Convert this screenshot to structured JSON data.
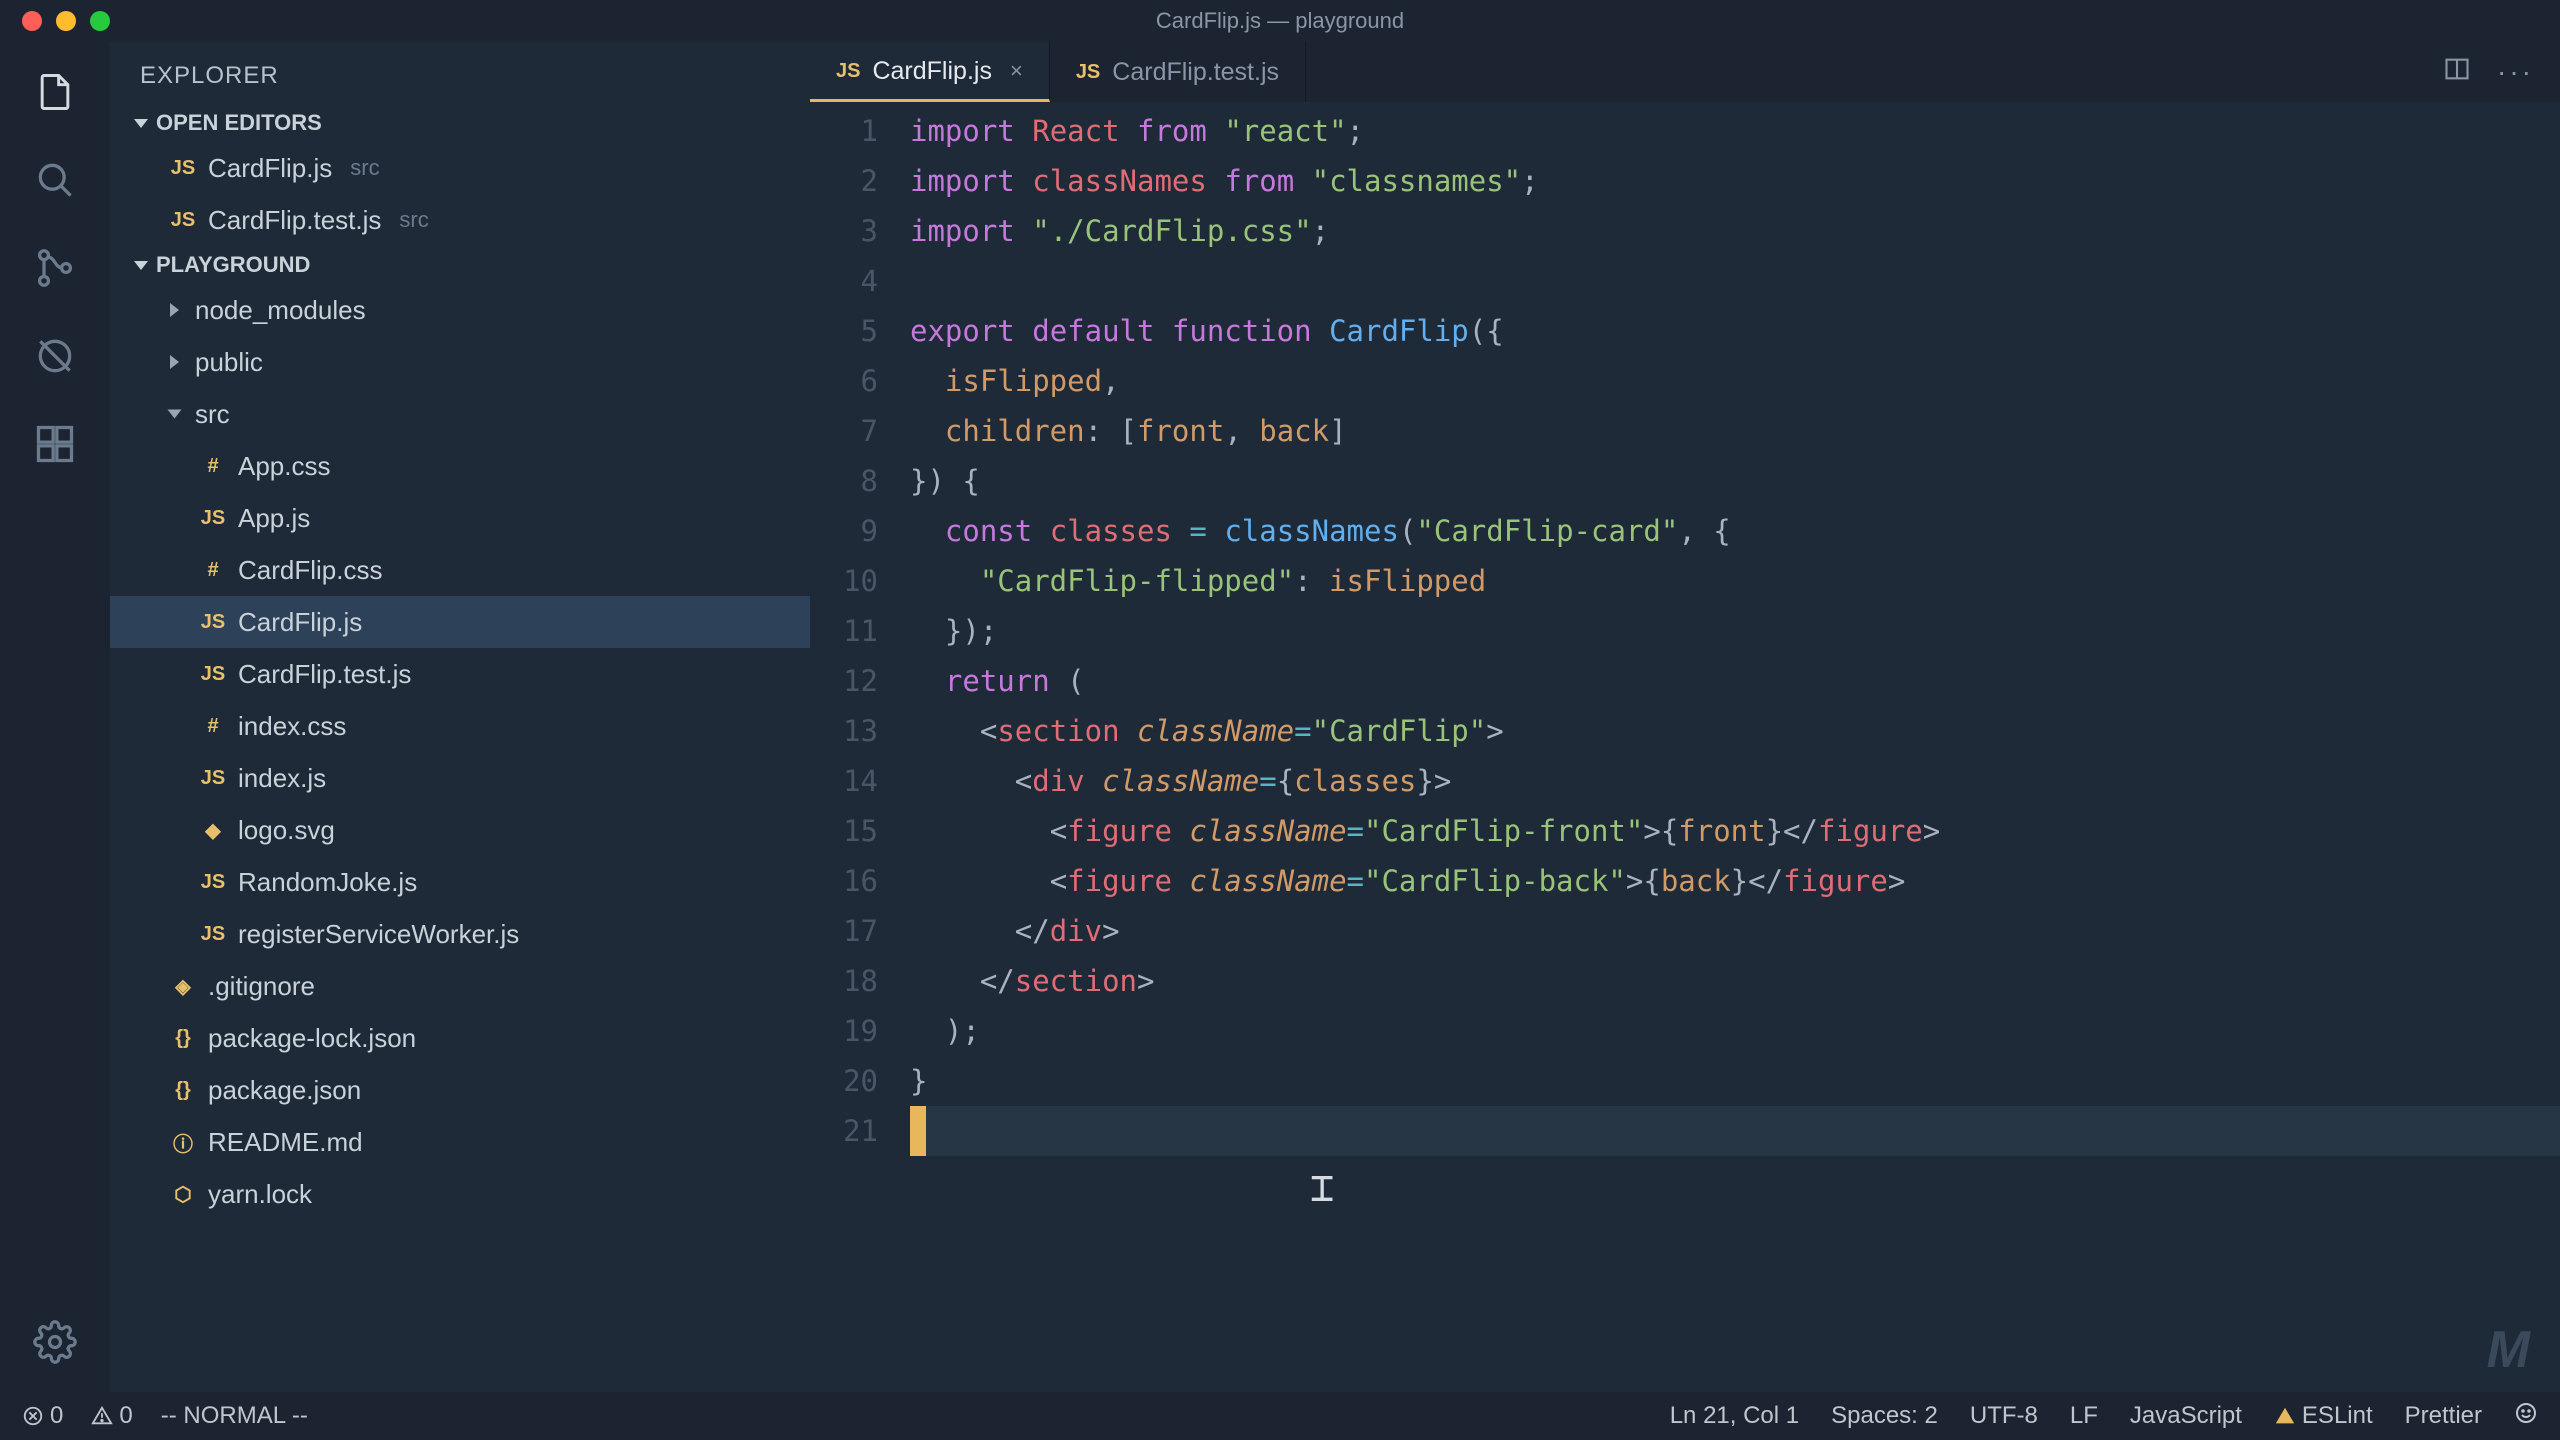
{
  "window_title": "CardFlip.js — playground",
  "sidebar": {
    "title": "EXPLORER",
    "open_editors_label": "OPEN EDITORS",
    "open_editors": [
      {
        "icon": "JS",
        "name": "CardFlip.js",
        "dir": "src"
      },
      {
        "icon": "JS",
        "name": "CardFlip.test.js",
        "dir": "src"
      }
    ],
    "project_label": "PLAYGROUND",
    "tree": [
      {
        "type": "folder",
        "name": "node_modules",
        "open": false,
        "indent": 1
      },
      {
        "type": "folder",
        "name": "public",
        "open": false,
        "indent": 1
      },
      {
        "type": "folder",
        "name": "src",
        "open": true,
        "indent": 1
      },
      {
        "type": "file",
        "icon": "#",
        "iconClass": "icon-hash",
        "name": "App.css",
        "indent": 2
      },
      {
        "type": "file",
        "icon": "JS",
        "iconClass": "icon-js",
        "name": "App.js",
        "indent": 2
      },
      {
        "type": "file",
        "icon": "#",
        "iconClass": "icon-hash",
        "name": "CardFlip.css",
        "indent": 2
      },
      {
        "type": "file",
        "icon": "JS",
        "iconClass": "icon-js",
        "name": "CardFlip.js",
        "indent": 2,
        "selected": true
      },
      {
        "type": "file",
        "icon": "JS",
        "iconClass": "icon-js",
        "name": "CardFlip.test.js",
        "indent": 2
      },
      {
        "type": "file",
        "icon": "#",
        "iconClass": "icon-hash",
        "name": "index.css",
        "indent": 2
      },
      {
        "type": "file",
        "icon": "JS",
        "iconClass": "icon-js",
        "name": "index.js",
        "indent": 2
      },
      {
        "type": "file",
        "icon": "◆",
        "iconClass": "icon-svg",
        "name": "logo.svg",
        "indent": 2
      },
      {
        "type": "file",
        "icon": "JS",
        "iconClass": "icon-js",
        "name": "RandomJoke.js",
        "indent": 2
      },
      {
        "type": "file",
        "icon": "JS",
        "iconClass": "icon-js",
        "name": "registerServiceWorker.js",
        "indent": 2
      },
      {
        "type": "file",
        "icon": "◈",
        "iconClass": "icon-git",
        "name": ".gitignore",
        "indent": 1
      },
      {
        "type": "file",
        "icon": "{}",
        "iconClass": "icon-braces",
        "name": "package-lock.json",
        "indent": 1
      },
      {
        "type": "file",
        "icon": "{}",
        "iconClass": "icon-braces",
        "name": "package.json",
        "indent": 1
      },
      {
        "type": "file",
        "icon": "ⓘ",
        "iconClass": "icon-info",
        "name": "README.md",
        "indent": 1
      },
      {
        "type": "file",
        "icon": "⬡",
        "iconClass": "icon-yarn",
        "name": "yarn.lock",
        "indent": 1
      }
    ]
  },
  "tabs": [
    {
      "icon": "JS",
      "label": "CardFlip.js",
      "active": true,
      "closeable": true
    },
    {
      "icon": "JS",
      "label": "CardFlip.test.js",
      "active": false,
      "closeable": false
    }
  ],
  "code": {
    "lines": [
      [
        [
          "kw",
          "import"
        ],
        [
          "plain",
          " "
        ],
        [
          "def",
          "React"
        ],
        [
          "plain",
          " "
        ],
        [
          "kw",
          "from"
        ],
        [
          "plain",
          " "
        ],
        [
          "str",
          "\"react\""
        ],
        [
          "punc",
          ";"
        ]
      ],
      [
        [
          "kw",
          "import"
        ],
        [
          "plain",
          " "
        ],
        [
          "def",
          "classNames"
        ],
        [
          "plain",
          " "
        ],
        [
          "kw",
          "from"
        ],
        [
          "plain",
          " "
        ],
        [
          "str",
          "\"classnames\""
        ],
        [
          "punc",
          ";"
        ]
      ],
      [
        [
          "kw",
          "import"
        ],
        [
          "plain",
          " "
        ],
        [
          "str",
          "\"./CardFlip.css\""
        ],
        [
          "punc",
          ";"
        ]
      ],
      [],
      [
        [
          "kw",
          "export"
        ],
        [
          "plain",
          " "
        ],
        [
          "kw",
          "default"
        ],
        [
          "plain",
          " "
        ],
        [
          "kw",
          "function"
        ],
        [
          "plain",
          " "
        ],
        [
          "fn",
          "CardFlip"
        ],
        [
          "punc",
          "({"
        ]
      ],
      [
        [
          "plain",
          "  "
        ],
        [
          "var",
          "isFlipped"
        ],
        [
          "punc",
          ","
        ]
      ],
      [
        [
          "plain",
          "  "
        ],
        [
          "var",
          "children"
        ],
        [
          "punc",
          ": ["
        ],
        [
          "var",
          "front"
        ],
        [
          "punc",
          ", "
        ],
        [
          "var",
          "back"
        ],
        [
          "punc",
          "]"
        ]
      ],
      [
        [
          "punc",
          "}) {"
        ]
      ],
      [
        [
          "plain",
          "  "
        ],
        [
          "const",
          "const"
        ],
        [
          "plain",
          " "
        ],
        [
          "def",
          "classes"
        ],
        [
          "plain",
          " "
        ],
        [
          "eq",
          "="
        ],
        [
          "plain",
          " "
        ],
        [
          "fn",
          "classNames"
        ],
        [
          "punc",
          "("
        ],
        [
          "str",
          "\"CardFlip-card\""
        ],
        [
          "punc",
          ", {"
        ]
      ],
      [
        [
          "plain",
          "    "
        ],
        [
          "str",
          "\"CardFlip-flipped\""
        ],
        [
          "punc",
          ": "
        ],
        [
          "var",
          "isFlipped"
        ]
      ],
      [
        [
          "plain",
          "  "
        ],
        [
          "punc",
          "});"
        ]
      ],
      [
        [
          "plain",
          "  "
        ],
        [
          "kw",
          "return"
        ],
        [
          "plain",
          " "
        ],
        [
          "punc",
          "("
        ]
      ],
      [
        [
          "plain",
          "    "
        ],
        [
          "punc",
          "<"
        ],
        [
          "tag",
          "section"
        ],
        [
          "plain",
          " "
        ],
        [
          "attr",
          "className"
        ],
        [
          "eq",
          "="
        ],
        [
          "str",
          "\"CardFlip\""
        ],
        [
          "punc",
          ">"
        ]
      ],
      [
        [
          "plain",
          "      "
        ],
        [
          "punc",
          "<"
        ],
        [
          "tag",
          "div"
        ],
        [
          "plain",
          " "
        ],
        [
          "attr",
          "className"
        ],
        [
          "eq",
          "="
        ],
        [
          "punc",
          "{"
        ],
        [
          "var",
          "classes"
        ],
        [
          "punc",
          "}>"
        ]
      ],
      [
        [
          "plain",
          "        "
        ],
        [
          "punc",
          "<"
        ],
        [
          "tag",
          "figure"
        ],
        [
          "plain",
          " "
        ],
        [
          "attr",
          "className"
        ],
        [
          "eq",
          "="
        ],
        [
          "str",
          "\"CardFlip-front\""
        ],
        [
          "punc",
          ">{"
        ],
        [
          "var",
          "front"
        ],
        [
          "punc",
          "}</"
        ],
        [
          "tag",
          "figure"
        ],
        [
          "punc",
          ">"
        ]
      ],
      [
        [
          "plain",
          "        "
        ],
        [
          "punc",
          "<"
        ],
        [
          "tag",
          "figure"
        ],
        [
          "plain",
          " "
        ],
        [
          "attr",
          "className"
        ],
        [
          "eq",
          "="
        ],
        [
          "str",
          "\"CardFlip-back\""
        ],
        [
          "punc",
          ">{"
        ],
        [
          "var",
          "back"
        ],
        [
          "punc",
          "}</"
        ],
        [
          "tag",
          "figure"
        ],
        [
          "punc",
          ">"
        ]
      ],
      [
        [
          "plain",
          "      "
        ],
        [
          "punc",
          "</"
        ],
        [
          "tag",
          "div"
        ],
        [
          "punc",
          ">"
        ]
      ],
      [
        [
          "plain",
          "    "
        ],
        [
          "punc",
          "</"
        ],
        [
          "tag",
          "section"
        ],
        [
          "punc",
          ">"
        ]
      ],
      [
        [
          "plain",
          "  "
        ],
        [
          "punc",
          ");"
        ]
      ],
      [
        [
          "punc",
          "}"
        ]
      ],
      []
    ],
    "current_line": 21
  },
  "statusbar": {
    "errors": "0",
    "warnings": "0",
    "vim_mode": "-- NORMAL --",
    "position": "Ln 21, Col 1",
    "spaces": "Spaces: 2",
    "encoding": "UTF-8",
    "eol": "LF",
    "language": "JavaScript",
    "lint": "ESLint",
    "formatter": "Prettier"
  }
}
